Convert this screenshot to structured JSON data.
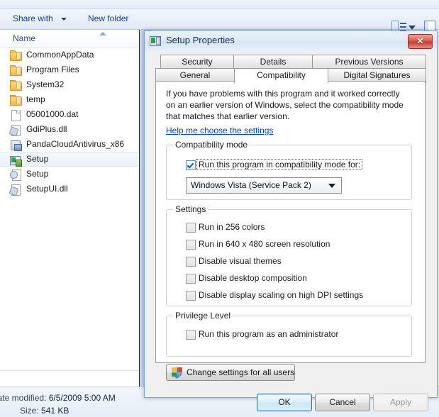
{
  "explorer": {
    "toolbar": {
      "share_with": "Share with",
      "new_folder": "New folder",
      "view_icon": "list-view-icon",
      "view_caret": "chevron-down-icon",
      "preview_pane_icon": "preview-pane-icon"
    },
    "column_header": {
      "name": "Name",
      "sort": "ascending"
    },
    "files": [
      {
        "name": "CommonAppData",
        "icon": "folder-icon",
        "selected": false
      },
      {
        "name": "Program Files",
        "icon": "folder-icon",
        "selected": false
      },
      {
        "name": "System32",
        "icon": "folder-icon",
        "selected": false
      },
      {
        "name": "temp",
        "icon": "folder-icon",
        "selected": false
      },
      {
        "name": "05001000.dat",
        "icon": "file-icon",
        "selected": false
      },
      {
        "name": "GdiPlus.dll",
        "icon": "dll-icon",
        "selected": false
      },
      {
        "name": "PandaCloudAntivirus_x86",
        "icon": "installer-icon",
        "selected": false
      },
      {
        "name": "Setup",
        "icon": "setup-app-icon",
        "selected": true
      },
      {
        "name": "Setup",
        "icon": "config-icon",
        "selected": false
      },
      {
        "name": "SetupUI.dll",
        "icon": "dll-icon",
        "selected": false
      }
    ],
    "status": {
      "date_modified_label": "Date modified:",
      "date_modified_value": "6/5/2009 5:00 AM",
      "size_label": "Size:",
      "size_value": "541 KB"
    }
  },
  "dialog": {
    "title": "Setup Properties",
    "title_icon": "setup-app-icon",
    "close_label": "✕",
    "tabs_row1": [
      {
        "label": "Security",
        "active": false
      },
      {
        "label": "Details",
        "active": false
      },
      {
        "label": "Previous Versions",
        "active": false
      }
    ],
    "tabs_row2": [
      {
        "label": "General",
        "active": false
      },
      {
        "label": "Compatibility",
        "active": true
      },
      {
        "label": "Digital Signatures",
        "active": false
      }
    ],
    "description": "If you have problems with this program and it worked correctly on an earlier version of Windows, select the compatibility mode that matches that earlier version.",
    "help_link": "Help me choose the settings",
    "compatibility_mode": {
      "group_label": "Compatibility mode",
      "checkbox_label": "Run this program in compatibility mode for:",
      "checked": true,
      "combo_value": "Windows Vista (Service Pack 2)",
      "combo_arrow": "chevron-down-icon"
    },
    "settings": {
      "group_label": "Settings",
      "items": [
        {
          "label": "Run in 256 colors",
          "checked": false
        },
        {
          "label": "Run in 640 x 480 screen resolution",
          "checked": false
        },
        {
          "label": "Disable visual themes",
          "checked": false
        },
        {
          "label": "Disable desktop composition",
          "checked": false
        },
        {
          "label": "Disable display scaling on high DPI settings",
          "checked": false
        }
      ]
    },
    "privilege": {
      "group_label": "Privilege Level",
      "checkbox_label": "Run this program as an administrator",
      "checked": false
    },
    "all_users_button": {
      "label": "Change settings for all users",
      "icon": "uac-shield-icon"
    },
    "buttons": {
      "ok": "OK",
      "cancel": "Cancel",
      "apply": "Apply",
      "apply_disabled": true
    }
  },
  "colors": {
    "accent_blue": "#2c74b5",
    "link_blue": "#0a44a8",
    "close_red": "#c23b30",
    "folder_yellow": "#f0b94e"
  }
}
